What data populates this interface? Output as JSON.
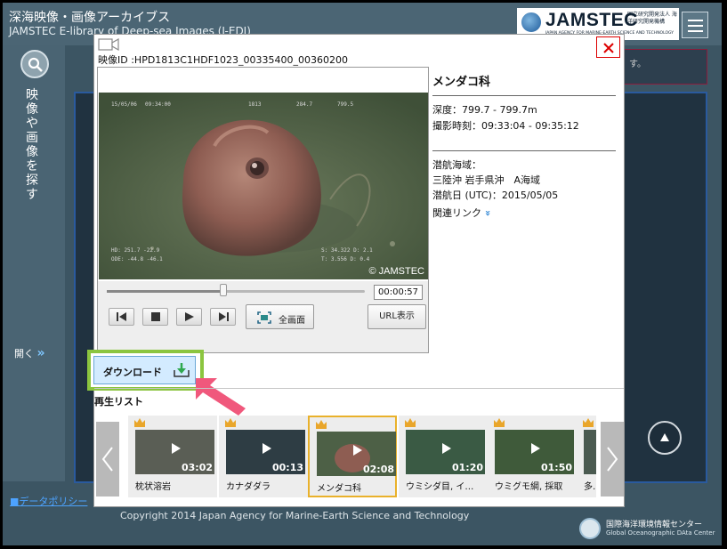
{
  "site": {
    "title": "深海映像・画像アーカイブス",
    "subtitle": "JAMSTEC E-library of Deep-sea Images (J-EDI)",
    "logo_word": "JAMSTEC",
    "logo_jp": "国立研究開発法人 海洋研究開発機構",
    "logo_en": "JAPAN AGENCY FOR MARINE-EARTH SCIENCE AND TECHNOLOGY",
    "search_label": "映像や画像を探す",
    "open_label": "開く",
    "open_chevron": "»",
    "notice_fragment": "す。",
    "data_policy": "■データポリシー",
    "copyright": "Copyright 2014 Japan Agency for Marine-Earth Science and Technology",
    "godac_jp": "国際海洋環境情報センター",
    "godac_en": "Global Oceanographic DAta Center"
  },
  "modal": {
    "video_id": "映像ID :HPD1813C1HDF1023_00335400_00360200",
    "video_watermark": "© JAMSTEC",
    "video_osd": {
      "date": "15/05/06",
      "time": "09:34:00",
      "dive": "1813",
      "hdg": "284.7",
      "depth": "799.5",
      "b1": "HD:  251.7   -22.9",
      "b2": "ODE:  -44.8  -46.1",
      "b3": "S:  34.322  D: 2.1",
      "b4": "T:   3.556  D: 0.4"
    },
    "time_display": "00:00:57",
    "fullscreen_label": "全画面",
    "url_label": "URL表示",
    "seek_position": 0.45,
    "info": {
      "species": "メンダコ科",
      "depth": "深度：799.7 - 799.7m",
      "shoot_time": "撮影時刻：09:33:04 - 09:35:12",
      "area_label": "潜航海域：",
      "area": "三陸沖 岩手県沖　A海域",
      "dive_date": "潜航日 (UTC)：2015/05/05",
      "related_link": "関連リンク",
      "related_chevron": "»"
    },
    "download_label": "ダウンロード",
    "playlist_label": "再生リスト",
    "playlist": [
      {
        "title": "枕状溶岩",
        "duration": "03:02",
        "bg": "#5a5e55"
      },
      {
        "title": "カナダダラ",
        "duration": "00:13",
        "bg": "#2e3d44"
      },
      {
        "title": "メンダコ科",
        "duration": "02:08",
        "bg": "#4d6046"
      },
      {
        "title": "ウミシダ目, イ…",
        "duration": "01:20",
        "bg": "#3a5a44"
      },
      {
        "title": "ウミグモ綱, 採取",
        "duration": "01:50",
        "bg": "#3f5a3a"
      },
      {
        "title": "多…",
        "duration": "",
        "bg": "#4a5a50"
      }
    ]
  },
  "colors": {
    "download_outline": "#8bc53f",
    "arrow": "#f0587c",
    "active_border": "#e9b12b",
    "close_red": "#dd0000"
  }
}
